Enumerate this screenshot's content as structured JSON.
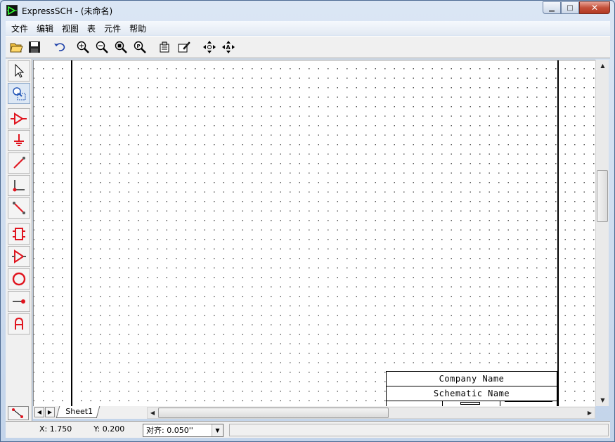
{
  "window": {
    "title": "ExpressSCH - (未命名)",
    "controls": {
      "minimize": "▁",
      "maximize": "□",
      "close": "✕"
    }
  },
  "menubar": {
    "items": [
      {
        "label": "文件"
      },
      {
        "label": "编辑"
      },
      {
        "label": "视图"
      },
      {
        "label": "表"
      },
      {
        "label": "元件"
      },
      {
        "label": "帮助"
      }
    ]
  },
  "toolbar": {
    "buttons": [
      "open-icon",
      "save-icon",
      "undo-icon",
      "zoom-in-icon",
      "zoom-out-icon",
      "zoom-fit-icon",
      "zoom-page-icon",
      "properties-icon",
      "edit-properties-icon",
      "pan-icon",
      "pan-auto-icon"
    ]
  },
  "palette": {
    "tools": [
      "pointer-icon",
      "zoom-area-icon",
      "component-icon",
      "ground-icon",
      "wire-icon",
      "corner-wire-icon",
      "diagonal-wire-icon",
      "ic-icon",
      "buffer-icon",
      "circle-icon",
      "pin-icon",
      "text-icon"
    ]
  },
  "canvas": {
    "title_block": {
      "company": "Company Name",
      "schematic": "Schematic Name"
    }
  },
  "sheets": {
    "tabs": [
      {
        "label": "Sheet1"
      }
    ]
  },
  "statusbar": {
    "x_coord": "X: 1.750",
    "y_coord": "Y: 0.200",
    "snap": "对齐: 0.050''"
  },
  "colors": {
    "accent_red": "#e0141e",
    "accent_blue": "#2457b8"
  }
}
